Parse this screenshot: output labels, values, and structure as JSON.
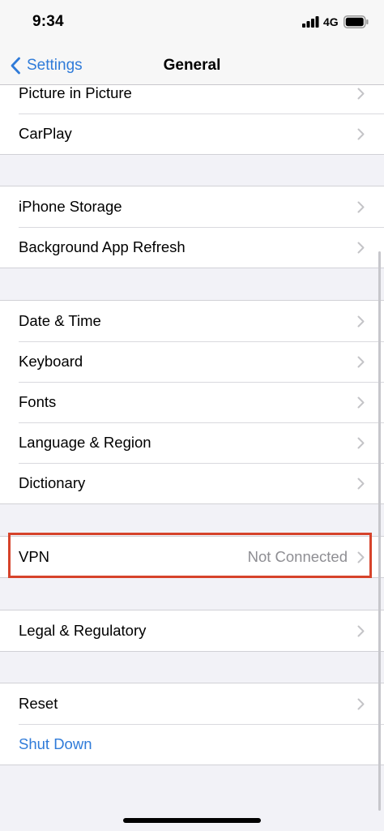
{
  "status_bar": {
    "time": "9:34",
    "network": "4G",
    "signal_icon": "cellular-signal-icon",
    "battery_icon": "battery-icon"
  },
  "nav": {
    "back_label": "Settings",
    "title": "General"
  },
  "groups": [
    {
      "rows": [
        {
          "label": "Picture in Picture"
        },
        {
          "label": "CarPlay"
        }
      ]
    },
    {
      "rows": [
        {
          "label": "iPhone Storage"
        },
        {
          "label": "Background App Refresh"
        }
      ]
    },
    {
      "rows": [
        {
          "label": "Date & Time"
        },
        {
          "label": "Keyboard"
        },
        {
          "label": "Fonts"
        },
        {
          "label": "Language & Region"
        },
        {
          "label": "Dictionary"
        }
      ]
    },
    {
      "rows": [
        {
          "label": "VPN",
          "value": "Not Connected"
        }
      ]
    },
    {
      "rows": [
        {
          "label": "Legal & Regulatory"
        }
      ]
    },
    {
      "rows": [
        {
          "label": "Reset"
        },
        {
          "label": "Shut Down"
        }
      ]
    }
  ],
  "colors": {
    "accent": "#2f7bd9",
    "highlight": "#d6432b",
    "background": "#f2f2f7"
  }
}
